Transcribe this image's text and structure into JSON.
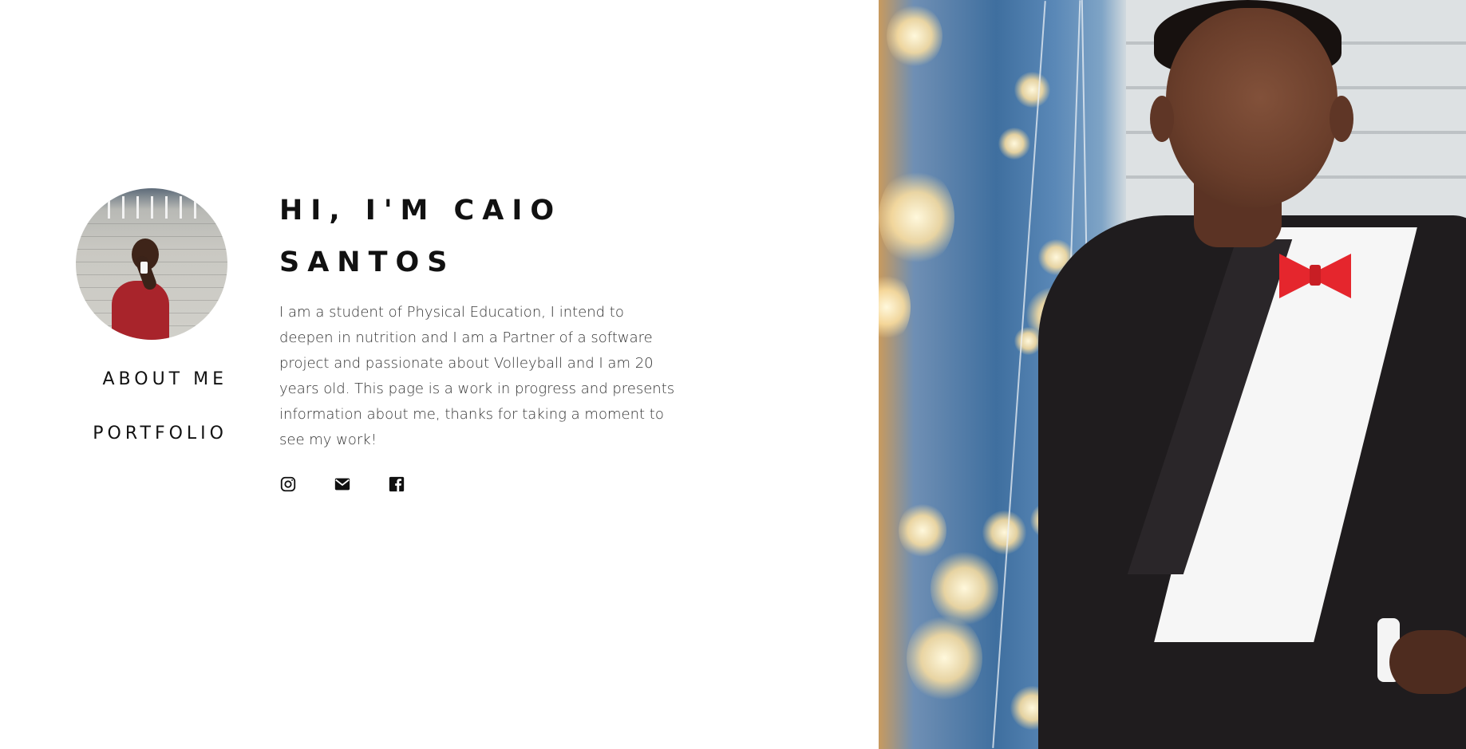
{
  "profile": {
    "avatar_alt": "Profile photo"
  },
  "nav": {
    "items": [
      {
        "label": "ABOUT ME"
      },
      {
        "label": "PORTFOLIO"
      }
    ]
  },
  "intro": {
    "heading": "HI, I'M CAIO SANTOS",
    "description": "I am a student of Physical Education, I intend to deepen in nutrition and I am a Partner of a software project and passionate about Volleyball and I am 20 years old. This page is a work in progress and presents information about me, thanks for taking a moment to see my work!"
  },
  "social": {
    "icons": [
      "instagram-icon",
      "mail-icon",
      "facebook-icon"
    ]
  },
  "colors": {
    "text": "#111111",
    "body_text": "#333333",
    "background": "#ffffff",
    "bowtie": "#e5262d"
  }
}
